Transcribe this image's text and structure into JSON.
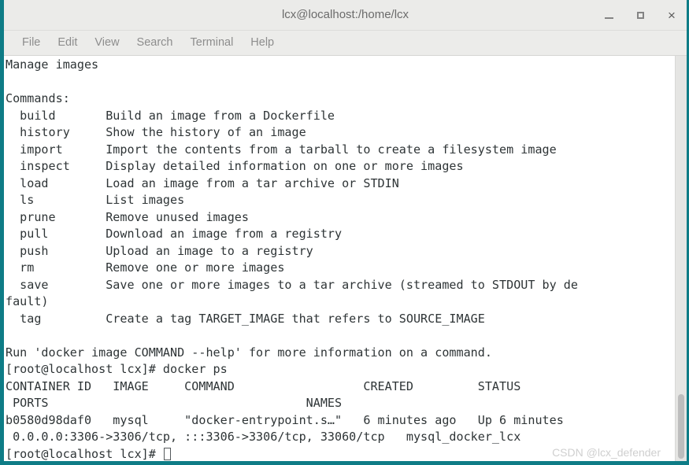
{
  "window": {
    "title": "lcx@localhost:/home/lcx",
    "accent_color": "#0e7c86",
    "titlebar_bg": "#ebebe9",
    "terminal_bg": "#ffffff",
    "terminal_fg": "#2e3436",
    "controls": {
      "minimize_label": "–",
      "maximize_label": "□",
      "close_label": "×"
    }
  },
  "menubar": {
    "items": [
      {
        "label": "File"
      },
      {
        "label": "Edit"
      },
      {
        "label": "View"
      },
      {
        "label": "Search"
      },
      {
        "label": "Terminal"
      },
      {
        "label": "Help"
      }
    ]
  },
  "terminal": {
    "cursor": "block-outline",
    "lines": [
      "Manage images",
      "",
      "Commands:",
      "  build       Build an image from a Dockerfile",
      "  history     Show the history of an image",
      "  import      Import the contents from a tarball to create a filesystem image",
      "  inspect     Display detailed information on one or more images",
      "  load        Load an image from a tar archive or STDIN",
      "  ls          List images",
      "  prune       Remove unused images",
      "  pull        Download an image from a registry",
      "  push        Upload an image to a registry",
      "  rm          Remove one or more images",
      "  save        Save one or more images to a tar archive (streamed to STDOUT by de",
      "fault)",
      "  tag         Create a tag TARGET_IMAGE that refers to SOURCE_IMAGE",
      "",
      "Run 'docker image COMMAND --help' for more information on a command.",
      "[root@localhost lcx]# docker ps",
      "CONTAINER ID   IMAGE     COMMAND                  CREATED         STATUS",
      " PORTS                                    NAMES",
      "b0580d98daf0   mysql     \"docker-entrypoint.s…\"   6 minutes ago   Up 6 minutes",
      " 0.0.0.0:3306->3306/tcp, :::3306->3306/tcp, 33060/tcp   mysql_docker_lcx"
    ],
    "prompt_last": "[root@localhost lcx]# "
  },
  "watermark": {
    "text": "CSDN @lcx_defender"
  },
  "scrollbar": {
    "thumb_color": "#bdbdbd",
    "track_color": "#e5e5e3"
  }
}
